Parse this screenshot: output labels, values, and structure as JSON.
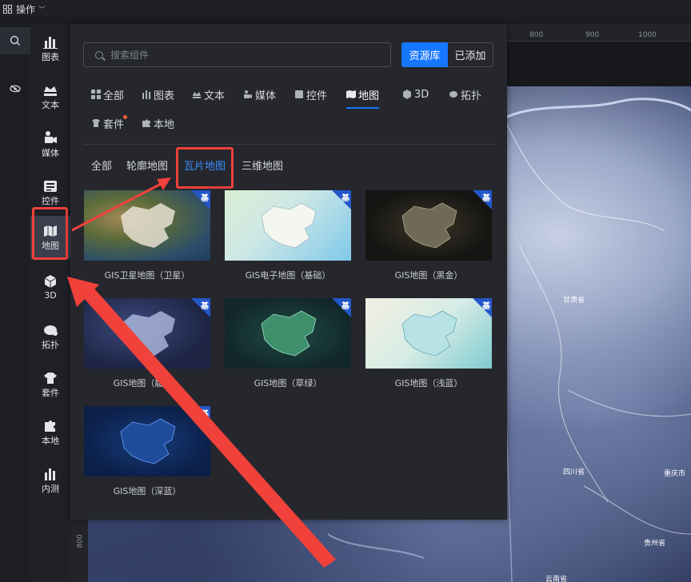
{
  "topbar": {
    "ops_label": "操作"
  },
  "sidebar": {
    "items": [
      {
        "label": "图表",
        "icon": "bar-chart-icon"
      },
      {
        "label": "文本",
        "icon": "text-crown-icon"
      },
      {
        "label": "媒体",
        "icon": "media-camera-icon"
      },
      {
        "label": "控件",
        "icon": "widget-icon"
      },
      {
        "label": "地图",
        "icon": "map-icon",
        "active": true
      },
      {
        "label": "3D",
        "icon": "cube-icon"
      },
      {
        "label": "拓扑",
        "icon": "topology-icon"
      },
      {
        "label": "套件",
        "icon": "kit-shirt-icon"
      },
      {
        "label": "本地",
        "icon": "puzzle-icon"
      },
      {
        "label": "内测",
        "icon": "beta-chart-icon"
      }
    ]
  },
  "panel": {
    "search_placeholder": "搜索组件",
    "segment": {
      "library": "资源库",
      "added": "已添加"
    },
    "tabs": [
      {
        "label": "全部"
      },
      {
        "label": "图表"
      },
      {
        "label": "文本"
      },
      {
        "label": "媒体"
      },
      {
        "label": "控件"
      },
      {
        "label": "地图",
        "active": true
      },
      {
        "label": "3D"
      },
      {
        "label": "拓扑"
      },
      {
        "label": "套件",
        "has_dot": true
      },
      {
        "label": "本地"
      }
    ],
    "subtabs": [
      {
        "label": "全部"
      },
      {
        "label": "轮廓地图"
      },
      {
        "label": "瓦片地图",
        "active": true
      },
      {
        "label": "三维地图"
      }
    ],
    "cards": [
      {
        "caption": "GIS卫星地图（卫星）",
        "badge": "基"
      },
      {
        "caption": "GIS电子地图（基础）",
        "badge": "基"
      },
      {
        "caption": "GIS地图（黑金）",
        "badge": "基"
      },
      {
        "caption": "GIS地图（靛黑）",
        "badge": "基"
      },
      {
        "caption": "GIS地图（草绿）",
        "badge": "基"
      },
      {
        "caption": "GIS地图（浅蓝）",
        "badge": "基"
      },
      {
        "caption": "GIS地图（深蓝）",
        "badge": "基"
      }
    ]
  },
  "canvas": {
    "ruler_top_labels": [
      "800",
      "900",
      "1000"
    ],
    "ruler_left_label": "800",
    "map_labels": [
      "甘肃省",
      "四川省",
      "重庆市",
      "贵州省",
      "云南省"
    ]
  },
  "colors": {
    "accent": "#1677ff",
    "highlight": "#f0413b",
    "badge": "#2357c9"
  }
}
